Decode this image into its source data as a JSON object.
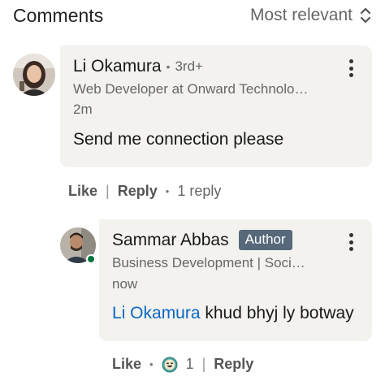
{
  "header": {
    "title": "Comments",
    "sort_label": "Most relevant"
  },
  "comment": {
    "author": "Li Okamura",
    "degree": "3rd+",
    "headline": "Web Developer at Onward Technolo…",
    "time": "2m",
    "text": "Send me connection please",
    "actions": {
      "like": "Like",
      "reply": "Reply",
      "replies_count": "1 reply"
    }
  },
  "reply": {
    "author": "Sammar Abbas",
    "badge": "Author",
    "headline": "Business Development | Soci…",
    "time": "now",
    "mention": "Li Okamura",
    "text": " khud bhyj ly botway",
    "actions": {
      "like": "Like",
      "reaction_count": "1",
      "reply": "Reply"
    }
  },
  "colors": {
    "bubble": "#f3f2ef",
    "mention": "#0a66c2",
    "badge": "#56687a",
    "online": "#057642"
  }
}
